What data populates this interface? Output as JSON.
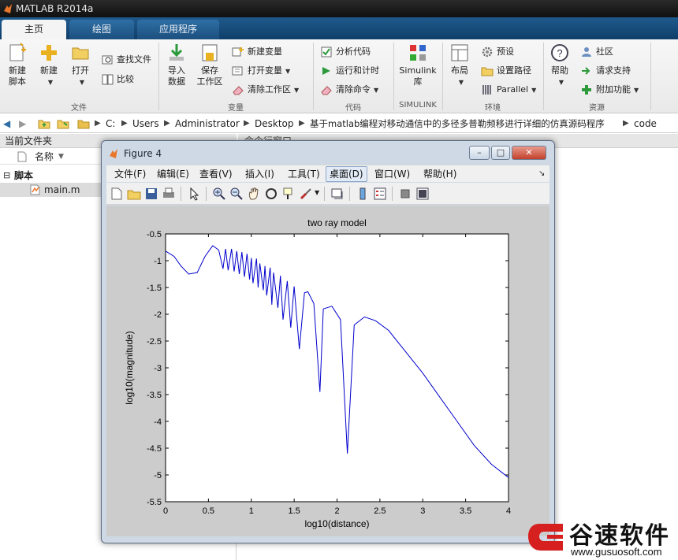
{
  "app": {
    "title": "MATLAB R2014a"
  },
  "tabs": [
    {
      "label": "主页",
      "active": true
    },
    {
      "label": "绘图",
      "active": false
    },
    {
      "label": "应用程序",
      "active": false
    }
  ],
  "ribbon": {
    "file": {
      "label": "文件",
      "new_script": "新建\n脚本",
      "new": "新建",
      "open": "打开",
      "find_files": "查找文件",
      "compare": "比较"
    },
    "variable": {
      "label": "变量",
      "import_data": "导入\n数据",
      "save_workspace": "保存\n工作区",
      "new_variable": "新建变量",
      "open_variable": "打开变量",
      "clear_workspace": "清除工作区"
    },
    "code": {
      "label": "代码",
      "analyze_code": "分析代码",
      "run_and_time": "运行和计时",
      "clear_commands": "清除命令"
    },
    "simulink": {
      "label": "SIMULINK",
      "simulink_lib": "Simulink\n库"
    },
    "environment": {
      "label": "环境",
      "layout": "布局",
      "preferences": "预设",
      "set_path": "设置路径",
      "parallel": "Parallel"
    },
    "resources": {
      "label": "资源",
      "help": "帮助",
      "community": "社区",
      "request_support": "请求支持",
      "add_ons": "附加功能"
    }
  },
  "address": {
    "crumbs": [
      "C:",
      "Users",
      "Administrator",
      "Desktop",
      "基于matlab编程对移动通信中的多径多普勒频移进行详细的仿真源码程序",
      "code"
    ]
  },
  "current_folder": {
    "title": "当前文件夹",
    "column_name": "名称",
    "group": "脚本",
    "file": "main.m"
  },
  "command_window": {
    "title": "命令行窗口"
  },
  "figure": {
    "title": "Figure 4",
    "menu": [
      {
        "label": "文件(F)",
        "active": false
      },
      {
        "label": "编辑(E)",
        "active": false
      },
      {
        "label": "查看(V)",
        "active": false
      },
      {
        "label": "插入(I)",
        "active": false
      },
      {
        "label": "工具(T)",
        "active": false
      },
      {
        "label": "桌面(D)",
        "active": true
      },
      {
        "label": "窗口(W)",
        "active": false
      },
      {
        "label": "帮助(H)",
        "active": false
      }
    ],
    "window_buttons": {
      "minimize": "–",
      "maximize": "□",
      "close": "✕"
    }
  },
  "watermark": {
    "brand": "谷速软件",
    "url": "www.gusuosoft.com"
  },
  "colors": {
    "line": "#0000cc",
    "ribbon_tab": "#1c4f7e",
    "canvas": "#cccccc",
    "brand": "#d62020"
  },
  "chart_data": {
    "type": "line",
    "title": "two ray model",
    "xlabel": "log10(distance)",
    "ylabel": "log10(magnitude)",
    "xlim": [
      0,
      4
    ],
    "ylim": [
      -5.5,
      -0.5
    ],
    "xticks": [
      0,
      0.5,
      1,
      1.5,
      2,
      2.5,
      3,
      3.5,
      4
    ],
    "yticks": [
      -5.5,
      -5,
      -4.5,
      -4,
      -3.5,
      -3,
      -2.5,
      -2,
      -1.5,
      -1,
      -0.5
    ],
    "grid": false,
    "series": [
      {
        "x": [
          0,
          0.1,
          0.18,
          0.27,
          0.37,
          0.46,
          0.55,
          0.62,
          0.67,
          0.7,
          0.73,
          0.77,
          0.8,
          0.83,
          0.86,
          0.89,
          0.92,
          0.95,
          0.98,
          1.0,
          1.02,
          1.06,
          1.08,
          1.1,
          1.14,
          1.16,
          1.18,
          1.22,
          1.24,
          1.26,
          1.31,
          1.34,
          1.37,
          1.42,
          1.46,
          1.5,
          1.56,
          1.62,
          1.66,
          1.73,
          1.8,
          1.84,
          1.94,
          2.04,
          2.12,
          2.2,
          2.32,
          2.45,
          2.6,
          2.8,
          3.0,
          3.2,
          3.4,
          3.6,
          3.8,
          4.0
        ],
        "y": [
          -0.82,
          -0.92,
          -1.1,
          -1.25,
          -1.22,
          -0.92,
          -0.72,
          -0.8,
          -1.15,
          -0.78,
          -1.18,
          -0.78,
          -1.2,
          -0.82,
          -1.25,
          -0.84,
          -1.3,
          -0.87,
          -1.35,
          -0.95,
          -1.42,
          -0.96,
          -1.5,
          -1.05,
          -1.55,
          -1.1,
          -1.65,
          -1.13,
          -1.82,
          -1.22,
          -1.88,
          -1.28,
          -2.1,
          -1.38,
          -2.25,
          -1.48,
          -2.65,
          -1.6,
          -1.58,
          -1.8,
          -3.45,
          -1.9,
          -1.85,
          -2.1,
          -4.6,
          -2.2,
          -2.05,
          -2.12,
          -2.3,
          -2.7,
          -3.1,
          -3.55,
          -4.0,
          -4.45,
          -4.8,
          -5.05
        ]
      }
    ]
  }
}
